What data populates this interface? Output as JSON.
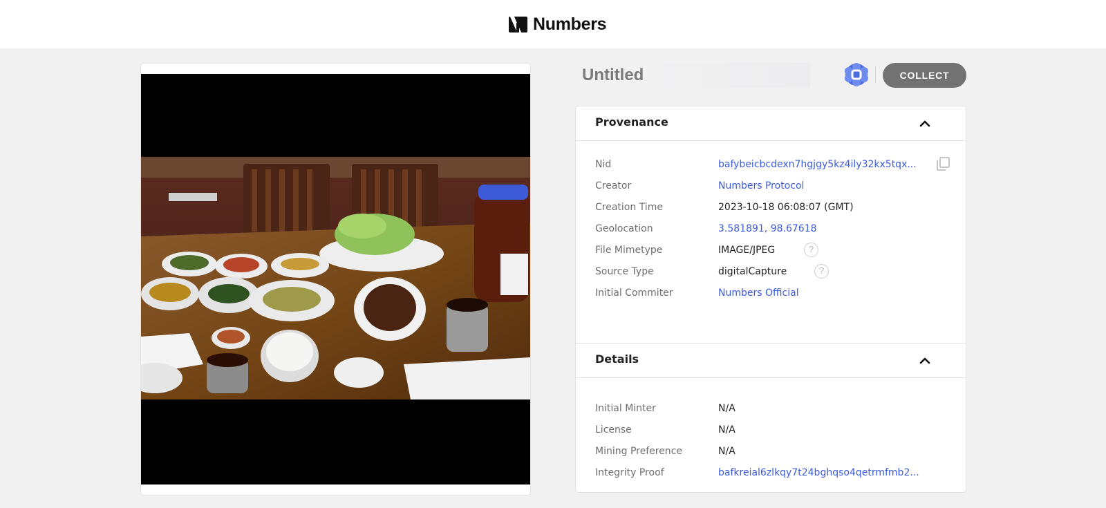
{
  "brand": {
    "name": "Numbers",
    "logo_icon": "numbers-logo-icon"
  },
  "asset": {
    "title": "Untitled",
    "badge_icon": "numbers-protocol-badge-icon",
    "collect_label": "COLLECT",
    "image_alt": "Korean meal with side dishes on a wooden table"
  },
  "provenance": {
    "title": "Provenance",
    "rows": [
      {
        "label": "Nid",
        "value": "bafybeicbcdexn7hgjgy5kz4ily32kx5tqx..."
      },
      {
        "label": "Creator",
        "value": "Numbers Protocol"
      },
      {
        "label": "Creation Time",
        "value": "2023-10-18 06:08:07 (GMT)"
      },
      {
        "label": "Geolocation",
        "value": "3.581891, 98.67618"
      },
      {
        "label": "File Mimetype",
        "value": "IMAGE/JPEG"
      },
      {
        "label": "Source Type",
        "value": "digitalCapture"
      },
      {
        "label": "Initial Commiter",
        "value": "Numbers Official"
      }
    ]
  },
  "details": {
    "title": "Details",
    "rows": [
      {
        "label": "Initial Minter",
        "value": "N/A"
      },
      {
        "label": "License",
        "value": "N/A"
      },
      {
        "label": "Mining Preference",
        "value": "N/A"
      },
      {
        "label": "Integrity Proof",
        "value": "bafkreial6zlkqy7t24bghqso4qetrmfmb2..."
      }
    ]
  },
  "colors": {
    "link": "#3b5bdb",
    "collect_bg": "#727272",
    "badge": "#4b6bdc",
    "page_bg": "#f1f1f2"
  }
}
